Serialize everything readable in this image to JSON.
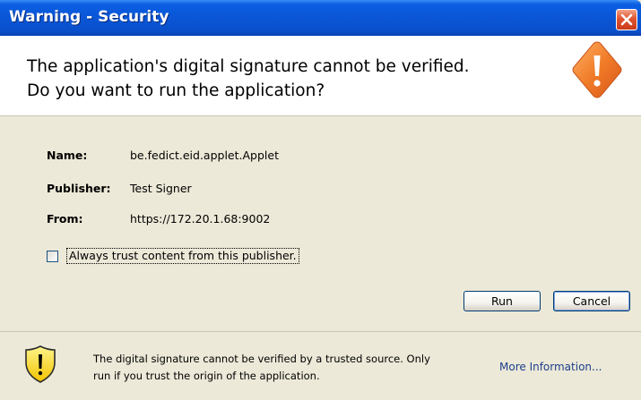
{
  "window": {
    "title": "Warning - Security"
  },
  "header": {
    "line1": "The application's digital signature cannot be verified.",
    "line2": "Do you want to run the application?"
  },
  "info": {
    "name_label": "Name:",
    "name_value": "be.fedict.eid.applet.Applet",
    "publisher_label": "Publisher:",
    "publisher_value": "Test Signer",
    "from_label": "From:",
    "from_value": "https://172.20.1.68:9002"
  },
  "checkbox": {
    "label": "Always trust content from this publisher.",
    "checked": false
  },
  "buttons": {
    "run": "Run",
    "cancel": "Cancel"
  },
  "footer": {
    "line1": "The digital signature cannot be verified by a trusted source.  Only",
    "line2": "run if you trust the origin of the application.",
    "more_info": "More Information..."
  },
  "icons": {
    "close": "close-icon",
    "header_warning": "warning-diamond-icon",
    "footer_warning": "warning-shield-icon"
  },
  "colors": {
    "titlebar": "#0a56d6",
    "dialog_bg": "#ece9d8",
    "warning_orange": "#f07c28",
    "link": "#1c3e8c"
  }
}
